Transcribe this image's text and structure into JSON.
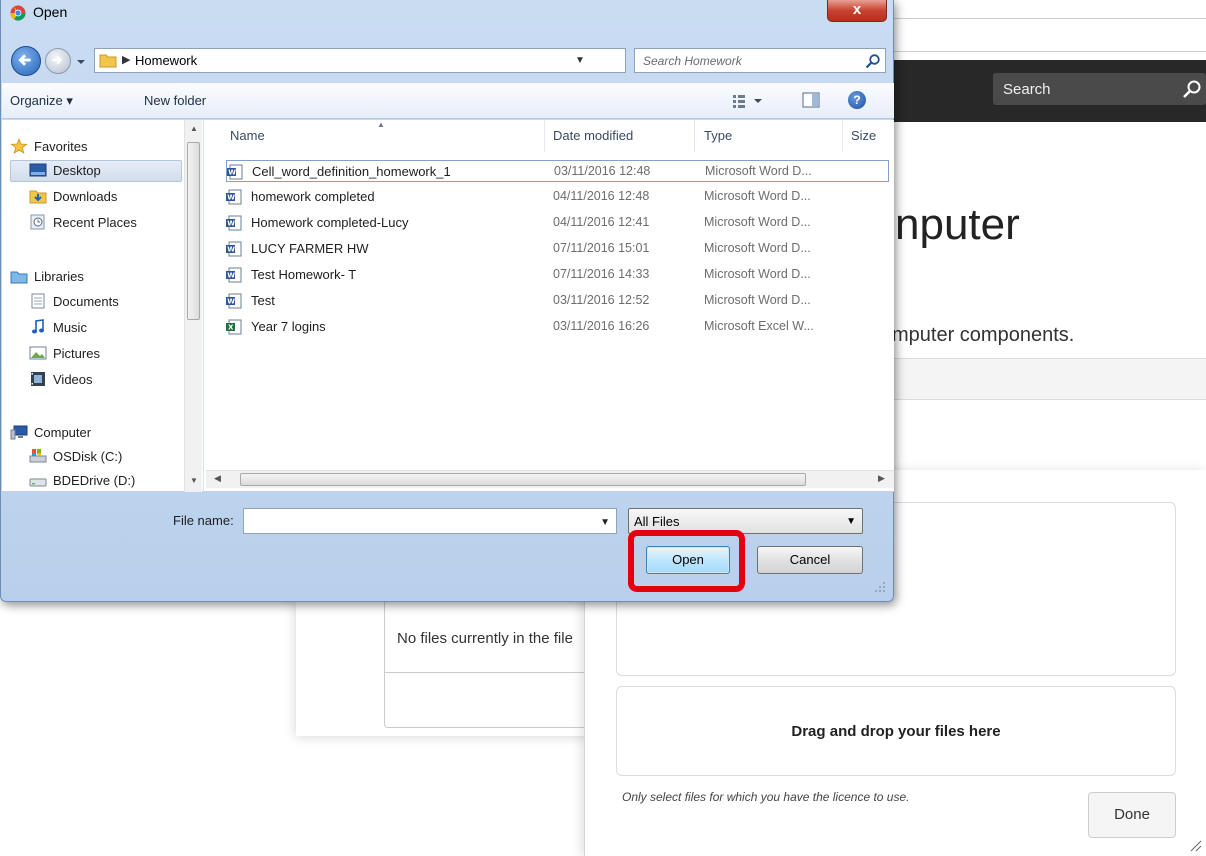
{
  "browser": {
    "search_placeholder": "Search",
    "heading_fragment": "nputer",
    "subtext_fragment": "mputer components.",
    "filelist_empty": "No files currently in the file",
    "drop_zone": "Drag and drop your files here",
    "licence_note": "Only select files for which you have the licence to use.",
    "done_label": "Done"
  },
  "dialog": {
    "title": "Open",
    "close_label": "x",
    "address_path": "Homework",
    "search_placeholder": "Search Homework",
    "toolbar": {
      "organize": "Organize ▾",
      "new_folder": "New folder"
    },
    "nav": {
      "favorites": "Favorites",
      "desktop": "Desktop",
      "downloads": "Downloads",
      "recent": "Recent Places",
      "libraries": "Libraries",
      "documents": "Documents",
      "music": "Music",
      "pictures": "Pictures",
      "videos": "Videos",
      "computer": "Computer",
      "osdisk": "OSDisk (C:)",
      "bdedrive": "BDEDrive (D:)"
    },
    "columns": {
      "name": "Name",
      "date": "Date modified",
      "type": "Type",
      "size": "Size"
    },
    "files": [
      {
        "name": "Cell_word_definition_homework_1",
        "date": "03/11/2016 12:48",
        "type": "Microsoft Word D..."
      },
      {
        "name": "homework completed",
        "date": "04/11/2016 12:48",
        "type": "Microsoft Word D..."
      },
      {
        "name": "Homework completed-Lucy",
        "date": "04/11/2016 12:41",
        "type": "Microsoft Word D..."
      },
      {
        "name": "LUCY FARMER HW",
        "date": "07/11/2016 15:01",
        "type": "Microsoft Word D..."
      },
      {
        "name": "Test Homework- T",
        "date": "07/11/2016 14:33",
        "type": "Microsoft Word D..."
      },
      {
        "name": "Test",
        "date": "03/11/2016 12:52",
        "type": "Microsoft Word D..."
      },
      {
        "name": "Year 7 logins",
        "date": "03/11/2016 16:26",
        "type": "Microsoft Excel W..."
      }
    ],
    "file_name_label": "File name:",
    "file_name_value": "",
    "filter": "All Files",
    "open_label": "Open",
    "cancel_label": "Cancel"
  },
  "colors": {
    "highlight": "#e4000f",
    "navbar": "#282828",
    "open_button": "#bee6fd"
  }
}
